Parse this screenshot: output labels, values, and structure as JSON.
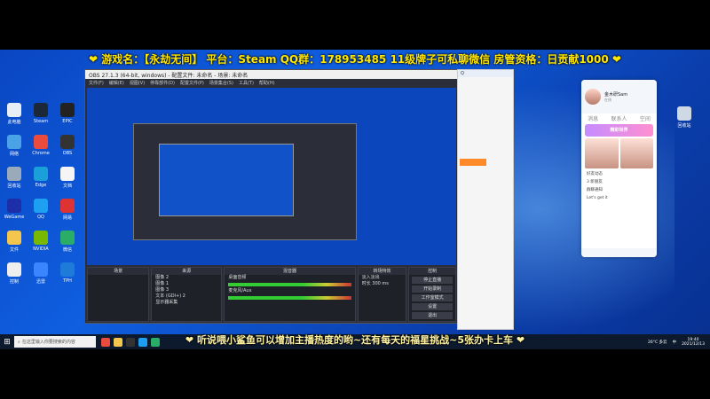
{
  "banner_top": "❤ 游戏名：【永劫无间】 平台：Steam QQ群：178953485 11级牌子可私聊微信 房管资格：日贡献1000 ❤",
  "banner_bottom": "❤ 听说喂小鲨鱼可以增加主播热度的哟~还有每天的福星挑战~5张办卡上车 ❤",
  "desktop_icons": [
    {
      "label": "此电脑",
      "color": "#e8eef6"
    },
    {
      "label": "Steam",
      "color": "#1b2838"
    },
    {
      "label": "EPIC",
      "color": "#222"
    },
    {
      "label": "网络",
      "color": "#4aa3e6"
    },
    {
      "label": "Chrome",
      "color": "#e94b3c"
    },
    {
      "label": "OBS",
      "color": "#333"
    },
    {
      "label": "回收站",
      "color": "#9ab"
    },
    {
      "label": "Edge",
      "color": "#1a9fd8"
    },
    {
      "label": "文档",
      "color": "#f5f5f5"
    },
    {
      "label": "WeGame",
      "color": "#1d2fa8"
    },
    {
      "label": "QQ",
      "color": "#1ea0f2"
    },
    {
      "label": "网易",
      "color": "#d33"
    },
    {
      "label": "文件",
      "color": "#f5c64d"
    },
    {
      "label": "NVIDIA",
      "color": "#76b900"
    },
    {
      "label": "微信",
      "color": "#2aae67"
    },
    {
      "label": "控制",
      "color": "#eee"
    },
    {
      "label": "迅雷",
      "color": "#3a86ff"
    },
    {
      "label": "TPH",
      "color": "#1e7bd9"
    }
  ],
  "recycle": {
    "label": "回收站"
  },
  "obs": {
    "title": "OBS 27.1.3 (64-bit, windows) - 配置文件: 未命名 - 场景: 未命名",
    "menu": [
      "文件(F)",
      "编辑(E)",
      "视图(V)",
      "停靠部件(D)",
      "配置文件(P)",
      "场景集合(S)",
      "工具(T)",
      "帮助(H)"
    ],
    "panels": {
      "scenes": "场景",
      "sources": "来源",
      "mixer": "混音器",
      "transitions": "转场特效",
      "controls": "控制"
    },
    "sources": [
      "图像 2",
      "图像 1",
      "图像 3",
      "文本 (GDI+) 2",
      "显示器采集"
    ],
    "mixer": [
      "桌面音频",
      "麦克风/Aux"
    ],
    "transition_select": "淡入淡出",
    "duration_label": "时长",
    "duration_value": "300 ms",
    "controls": [
      "停止直播",
      "开始录制",
      "工作室模式",
      "设置",
      "退出"
    ]
  },
  "qq": {
    "name": "金木研Sam",
    "status": "在线",
    "tabs": [
      "消息",
      "联系人",
      "空间"
    ],
    "banner": "精彩世界",
    "rows": [
      "好友动态",
      "3 新朋友",
      "群聊通知",
      "Let's get it"
    ]
  },
  "taskbar": {
    "search_placeholder": "在这里输入你要搜索的内容",
    "time": "19:40",
    "date": "2021/12/13",
    "temp": "26°C 多云",
    "lang": "中"
  }
}
